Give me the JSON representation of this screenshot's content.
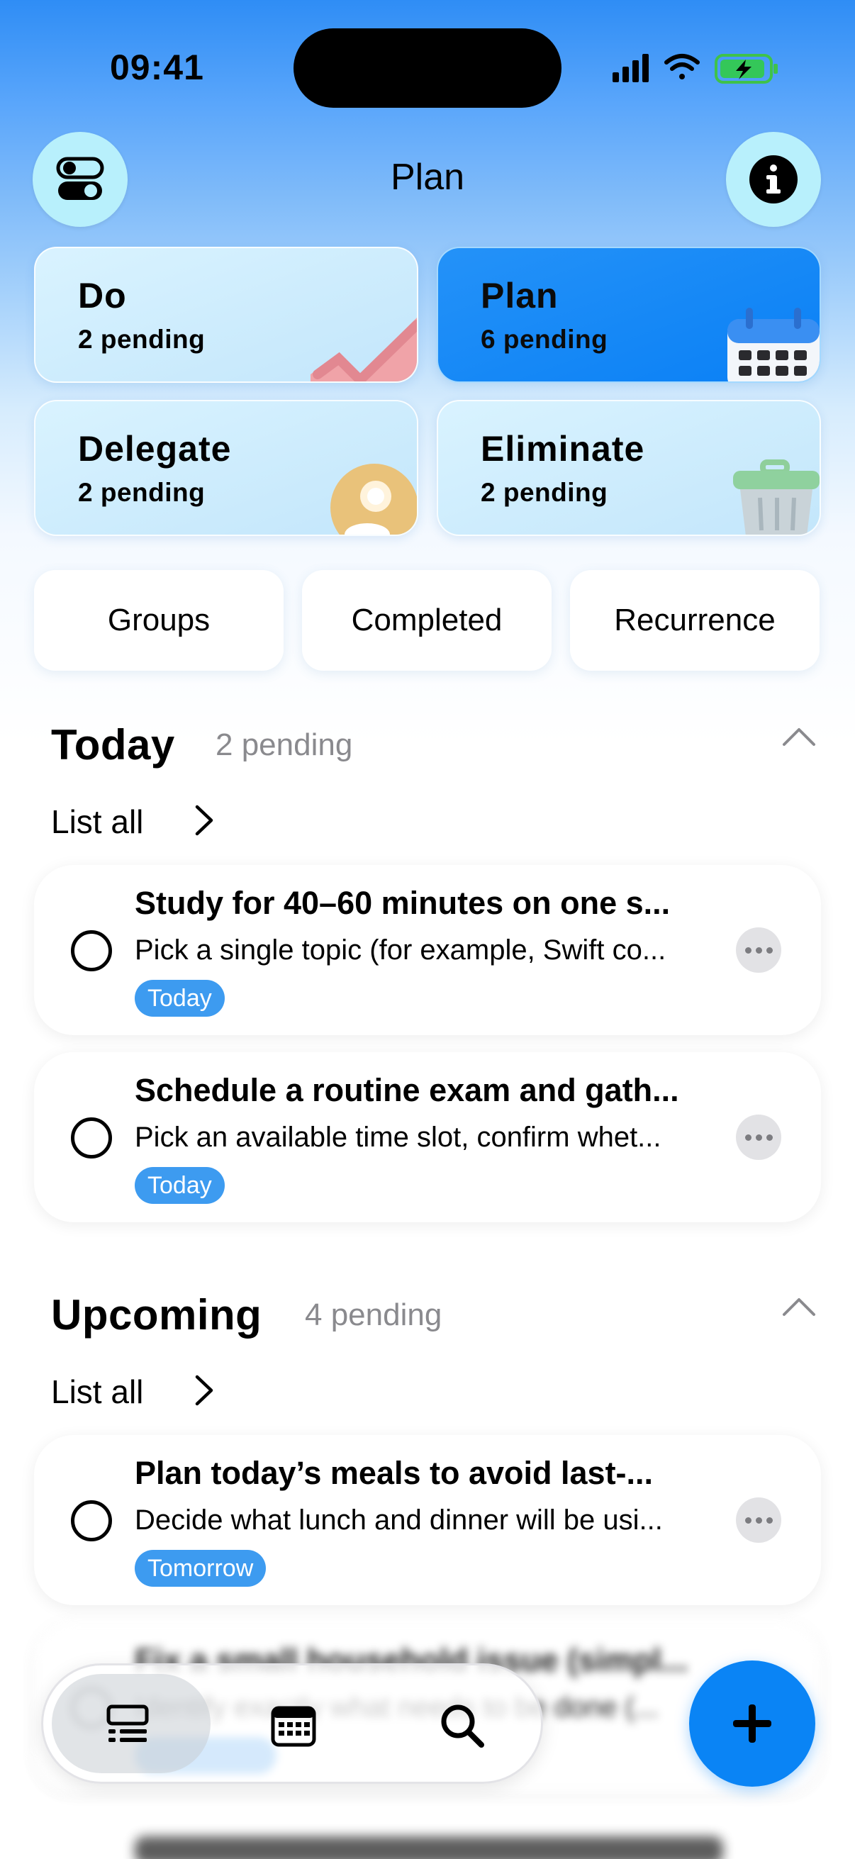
{
  "status_bar": {
    "time": "09:41"
  },
  "header": {
    "title": "Plan",
    "left_icon": "toggle-icon",
    "right_icon": "info-icon"
  },
  "quadrants": [
    {
      "title": "Do",
      "subtitle": "2 pending",
      "active": false,
      "art": "checkmark-art"
    },
    {
      "title": "Plan",
      "subtitle": "6 pending",
      "active": true,
      "art": "calendar-art"
    },
    {
      "title": "Delegate",
      "subtitle": "2 pending",
      "active": false,
      "art": "people-art"
    },
    {
      "title": "Eliminate",
      "subtitle": "2 pending",
      "active": false,
      "art": "trash-art"
    }
  ],
  "filters": [
    "Groups",
    "Completed",
    "Recurrence"
  ],
  "sections": {
    "today": {
      "title": "Today",
      "count": "2 pending",
      "list_all": "List all",
      "tasks": [
        {
          "title": "Study for 40–60 minutes on one s...",
          "desc": "Pick a single topic (for example, Swift co...",
          "tag": "Today"
        },
        {
          "title": "Schedule a routine exam and gath...",
          "desc": "Pick an available time slot, confirm whet...",
          "tag": "Today"
        }
      ]
    },
    "upcoming": {
      "title": "Upcoming",
      "count": "4 pending",
      "list_all": "List all",
      "tasks": [
        {
          "title": "Plan today’s meals to avoid last-...",
          "desc": "Decide what lunch and dinner will be usi...",
          "tag": "Tomorrow"
        },
        {
          "title": "Fix a small household issue (simpl...",
          "desc": "Identify exactly what needs to be done (...",
          "tag": ""
        }
      ]
    }
  },
  "tabbar": {
    "tabs": [
      "list-icon",
      "calendar-icon",
      "search-icon"
    ],
    "active": "list-icon"
  },
  "fab": {
    "icon": "plus-icon"
  },
  "colors": {
    "accent": "#0A84F5",
    "tag": "#3D9BF0",
    "header_circle": "#B8F0FC"
  }
}
